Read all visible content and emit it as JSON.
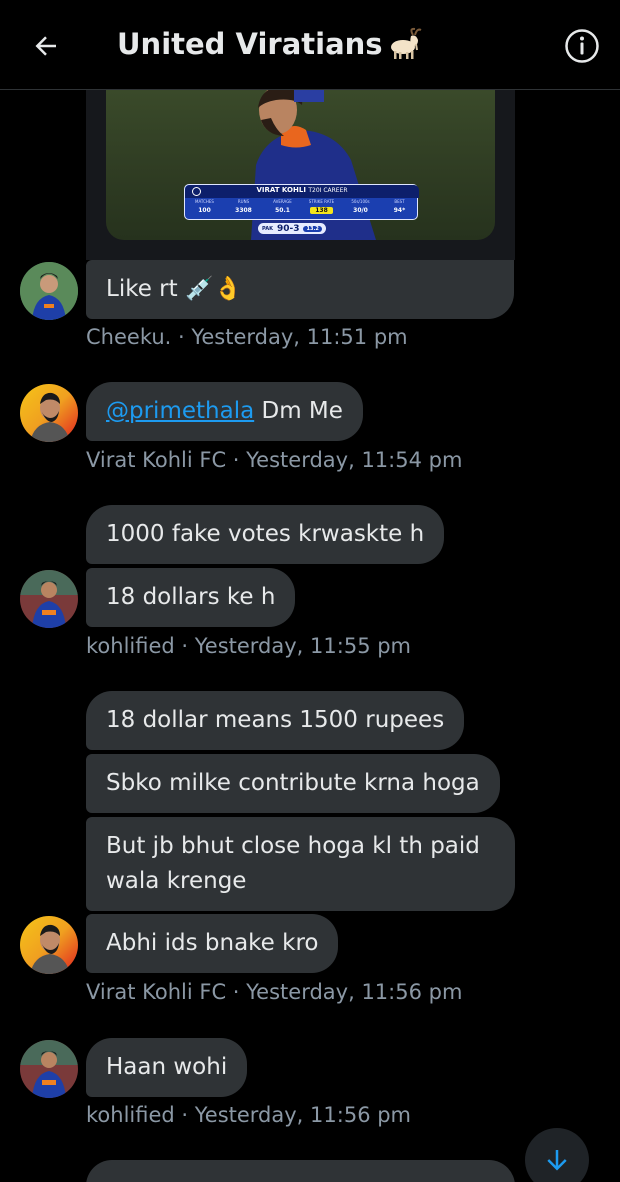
{
  "header": {
    "title": "United Viratians",
    "back_icon": "arrow-left-icon",
    "info_icon": "info-icon"
  },
  "media": {
    "scorecard": {
      "name": "VIRAT KOHLI",
      "subtitle": "T20I CAREER",
      "columns": [
        "MATCHES",
        "RUNS",
        "AVERAGE",
        "STRIKE RATE",
        "50s/100s",
        "BEST"
      ],
      "values": [
        "100",
        "3308",
        "50.1",
        "138",
        "30/0",
        "94*"
      ],
      "score_team": "PAK",
      "score": "90-3",
      "overs": "13.2"
    }
  },
  "messages": [
    {
      "text": "Like rt 💉👌"
    },
    {
      "meta": "Cheeku. · Yesterday, 11:51 pm"
    },
    {
      "mention": "@primethala",
      "text": " Dm Me"
    },
    {
      "meta": "Virat Kohli FC · Yesterday, 11:54 pm"
    },
    {
      "text": "1000 fake votes krwaskte h"
    },
    {
      "text": "18 dollars ke h"
    },
    {
      "meta": "kohlified · Yesterday, 11:55 pm"
    },
    {
      "text": "18 dollar means 1500 rupees"
    },
    {
      "text": "Sbko milke contribute krna hoga"
    },
    {
      "text": "But jb bhut close hoga kl th paid wala krenge"
    },
    {
      "text": "Abhi ids bnake kro"
    },
    {
      "meta": "Virat Kohli FC · Yesterday, 11:56 pm"
    },
    {
      "text": "Haan wohi"
    },
    {
      "meta": "kohlified · Yesterday, 11:56 pm"
    }
  ],
  "scroll_icon": "arrow-down-icon",
  "colors": {
    "background": "#000000",
    "bubble": "#2f3336",
    "text": "#e7e9ea",
    "meta": "#8b98a5",
    "link": "#1d9bf0"
  }
}
